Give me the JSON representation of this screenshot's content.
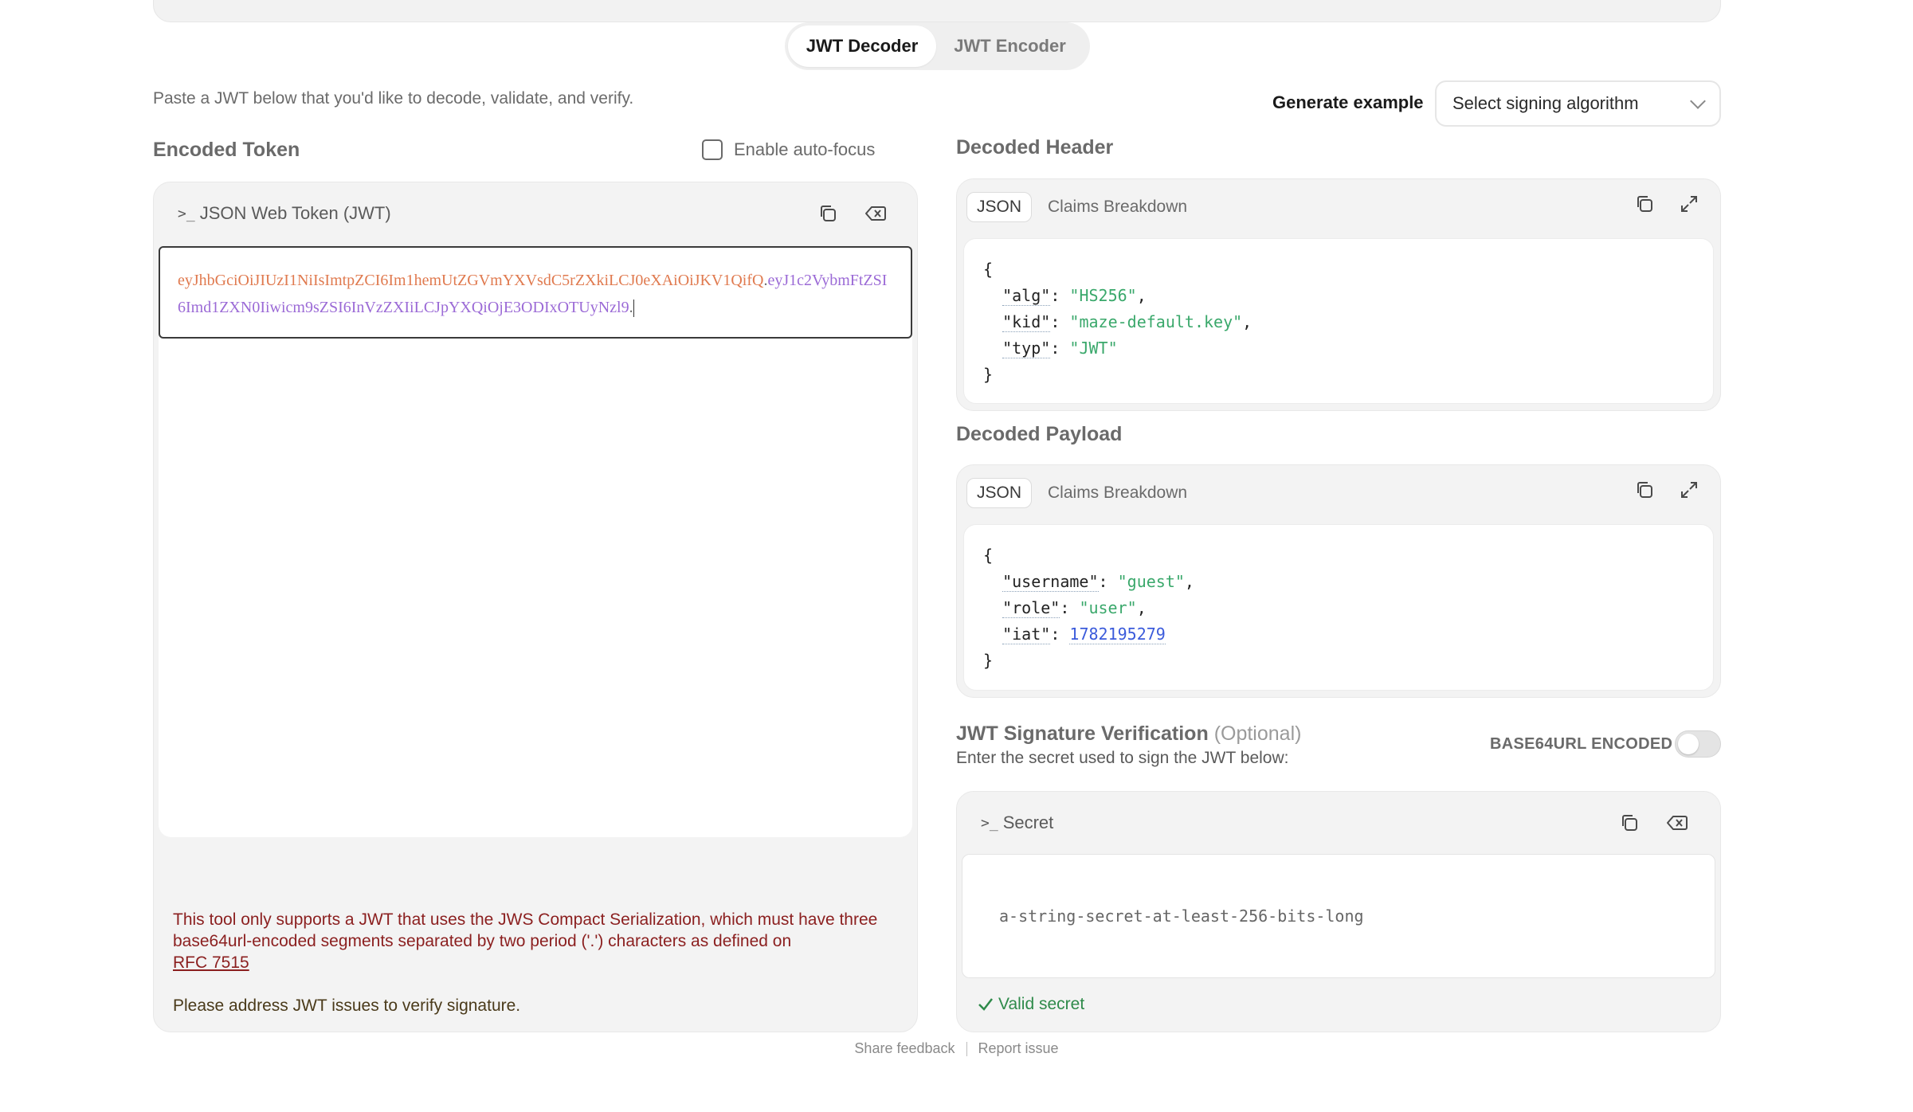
{
  "tabs": {
    "decoder": "JWT Decoder",
    "encoder": "JWT Encoder"
  },
  "intro": "Paste a JWT below that you'd like to decode, validate, and verify.",
  "generate_example": "Generate example",
  "algorithm_select": {
    "value": "Select signing algorithm"
  },
  "encoded": {
    "title": "Encoded Token",
    "autofocus_label": "Enable auto-focus",
    "panel_label": "JSON Web Token (JWT)",
    "token_header": "eyJhbGciOiJIUzI1NiIsImtpZCI6Im1hemUtZGVmYXVsdC5rZXkiLCJ0eXAiOiJKV1QifQ",
    "token_dot1": ".",
    "token_payload": "eyJ1c2VybmFtZSI6Imd1ZXN0Iiwicm9sZSI6InVzZXIiLCJpYXQiOjE3ODIxOTUyNzl9",
    "token_dot2": ".",
    "error_text": "This tool only supports a JWT that uses the JWS Compact Serialization, which must have three base64url-encoded segments separated by two period ('.') characters as defined on",
    "error_link": "RFC 7515",
    "issue_text": "Please address JWT issues to verify signature."
  },
  "header": {
    "title": "Decoded Header",
    "tab_json": "JSON",
    "tab_claims": "Claims Breakdown",
    "fields": [
      {
        "key": "\"alg\"",
        "value": "\"HS256\"",
        "comma": ","
      },
      {
        "key": "\"kid\"",
        "value": "\"maze-default.key\"",
        "comma": ","
      },
      {
        "key": "\"typ\"",
        "value": "\"JWT\"",
        "comma": ""
      }
    ]
  },
  "payload": {
    "title": "Decoded Payload",
    "tab_json": "JSON",
    "tab_claims": "Claims Breakdown",
    "fields": [
      {
        "key": "\"username\"",
        "value": "\"guest\"",
        "comma": ","
      },
      {
        "key": "\"role\"",
        "value": "\"user\"",
        "comma": ","
      },
      {
        "key": "\"iat\"",
        "value": "1782195279",
        "comma": ""
      }
    ]
  },
  "signature": {
    "title": "JWT Signature Verification",
    "optional": "(Optional)",
    "subtitle": "Enter the secret used to sign the JWT below:",
    "b64_label": "BASE64URL ENCODED",
    "b64_enabled": false,
    "panel_label": "Secret",
    "secret_value": "a-string-secret-at-least-256-bits-long",
    "valid_text": "Valid secret"
  },
  "brace_open": "{",
  "brace_close": "}",
  "colon": ": ",
  "prompt_glyph": ">_",
  "footer": {
    "feedback": "Share feedback",
    "report": "Report issue"
  },
  "colors": {
    "token_header": "#e07a4f",
    "token_payload": "#9b6ad6",
    "string": "#3aa86b",
    "number": "#3b5bdb",
    "valid": "#2e8a4a",
    "error": "#8b1f1f"
  }
}
